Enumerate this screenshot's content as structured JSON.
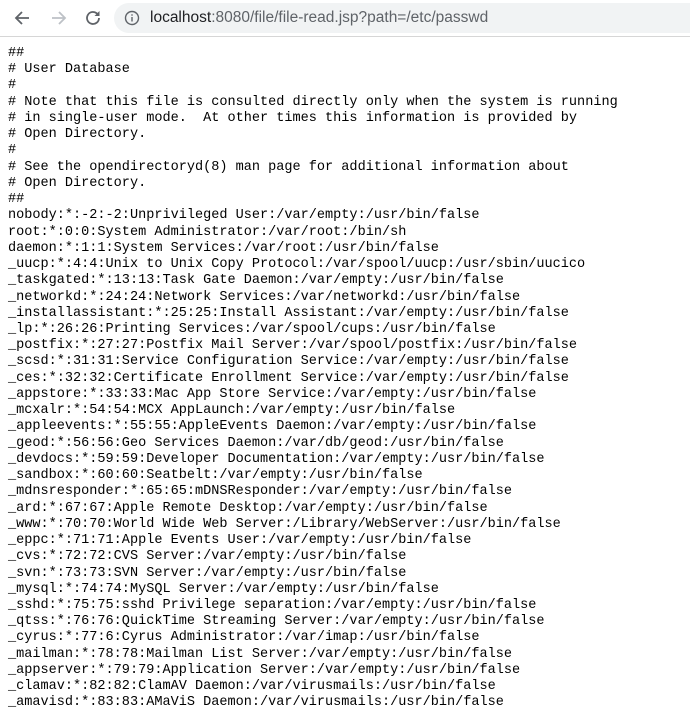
{
  "browser": {
    "back_icon": "arrow-left-icon",
    "forward_icon": "arrow-right-icon",
    "reload_icon": "reload-icon",
    "info_icon": "info-circle-icon",
    "url_host": "localhost",
    "url_rest": ":8080/file/file-read.jsp?path=/etc/passwd"
  },
  "content": {
    "lines": [
      "##",
      "# User Database",
      "#",
      "# Note that this file is consulted directly only when the system is running",
      "# in single-user mode.  At other times this information is provided by",
      "# Open Directory.",
      "#",
      "# See the opendirectoryd(8) man page for additional information about",
      "# Open Directory.",
      "##",
      "nobody:*:-2:-2:Unprivileged User:/var/empty:/usr/bin/false",
      "root:*:0:0:System Administrator:/var/root:/bin/sh",
      "daemon:*:1:1:System Services:/var/root:/usr/bin/false",
      "_uucp:*:4:4:Unix to Unix Copy Protocol:/var/spool/uucp:/usr/sbin/uucico",
      "_taskgated:*:13:13:Task Gate Daemon:/var/empty:/usr/bin/false",
      "_networkd:*:24:24:Network Services:/var/networkd:/usr/bin/false",
      "_installassistant:*:25:25:Install Assistant:/var/empty:/usr/bin/false",
      "_lp:*:26:26:Printing Services:/var/spool/cups:/usr/bin/false",
      "_postfix:*:27:27:Postfix Mail Server:/var/spool/postfix:/usr/bin/false",
      "_scsd:*:31:31:Service Configuration Service:/var/empty:/usr/bin/false",
      "_ces:*:32:32:Certificate Enrollment Service:/var/empty:/usr/bin/false",
      "_appstore:*:33:33:Mac App Store Service:/var/empty:/usr/bin/false",
      "_mcxalr:*:54:54:MCX AppLaunch:/var/empty:/usr/bin/false",
      "_appleevents:*:55:55:AppleEvents Daemon:/var/empty:/usr/bin/false",
      "_geod:*:56:56:Geo Services Daemon:/var/db/geod:/usr/bin/false",
      "_devdocs:*:59:59:Developer Documentation:/var/empty:/usr/bin/false",
      "_sandbox:*:60:60:Seatbelt:/var/empty:/usr/bin/false",
      "_mdnsresponder:*:65:65:mDNSResponder:/var/empty:/usr/bin/false",
      "_ard:*:67:67:Apple Remote Desktop:/var/empty:/usr/bin/false",
      "_www:*:70:70:World Wide Web Server:/Library/WebServer:/usr/bin/false",
      "_eppc:*:71:71:Apple Events User:/var/empty:/usr/bin/false",
      "_cvs:*:72:72:CVS Server:/var/empty:/usr/bin/false",
      "_svn:*:73:73:SVN Server:/var/empty:/usr/bin/false",
      "_mysql:*:74:74:MySQL Server:/var/empty:/usr/bin/false",
      "_sshd:*:75:75:sshd Privilege separation:/var/empty:/usr/bin/false",
      "_qtss:*:76:76:QuickTime Streaming Server:/var/empty:/usr/bin/false",
      "_cyrus:*:77:6:Cyrus Administrator:/var/imap:/usr/bin/false",
      "_mailman:*:78:78:Mailman List Server:/var/empty:/usr/bin/false",
      "_appserver:*:79:79:Application Server:/var/empty:/usr/bin/false",
      "_clamav:*:82:82:ClamAV Daemon:/var/virusmails:/usr/bin/false",
      "_amavisd:*:83:83:AMaViS Daemon:/var/virusmails:/usr/bin/false"
    ]
  }
}
